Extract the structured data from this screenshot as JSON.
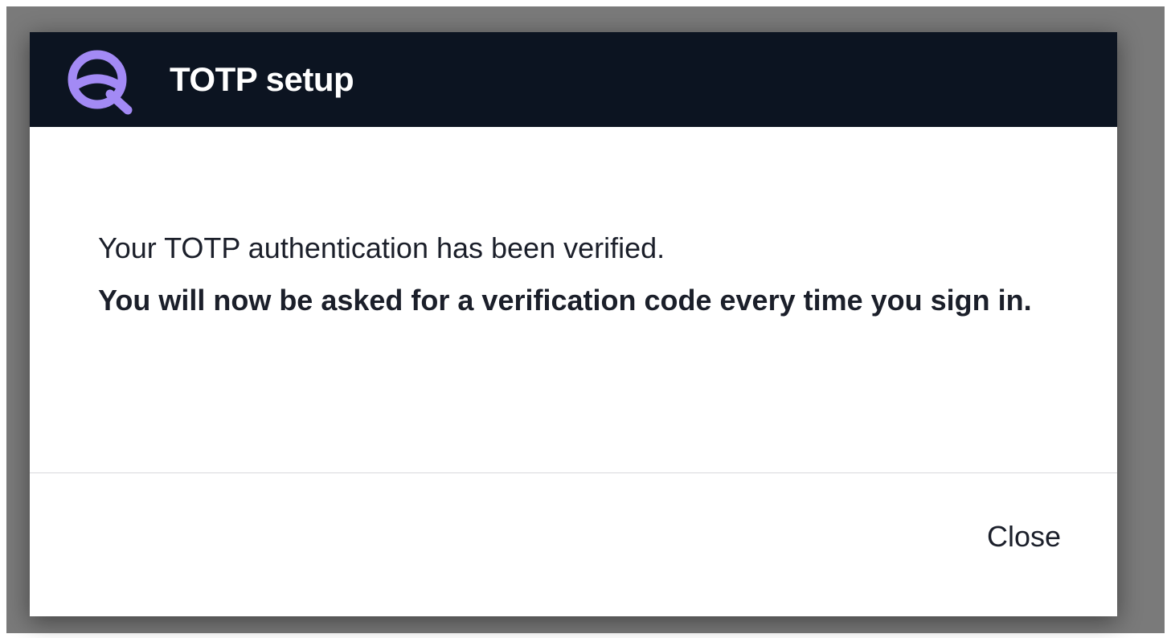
{
  "dialog": {
    "title": "TOTP setup",
    "logo_icon": "app-logo-icon",
    "accent_color": "#a38af5",
    "header_color": "#0c1421"
  },
  "body": {
    "message": "Your TOTP authentication has been verified.",
    "notice": "You will now be asked for a verification code every time you sign in."
  },
  "footer": {
    "close_label": "Close"
  }
}
